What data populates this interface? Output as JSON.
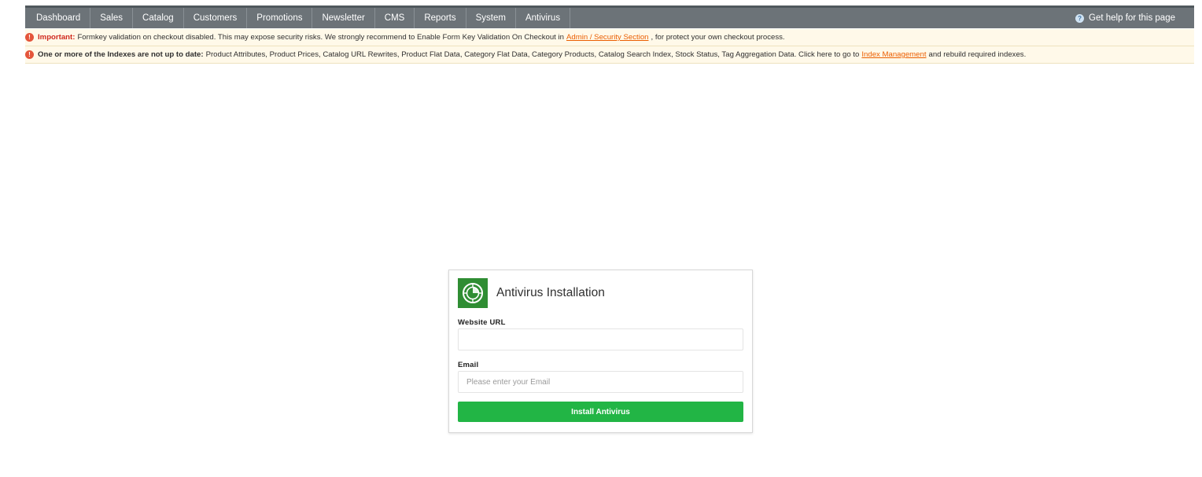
{
  "nav": {
    "items": [
      {
        "label": "Dashboard"
      },
      {
        "label": "Sales"
      },
      {
        "label": "Catalog"
      },
      {
        "label": "Customers"
      },
      {
        "label": "Promotions"
      },
      {
        "label": "Newsletter"
      },
      {
        "label": "CMS"
      },
      {
        "label": "Reports"
      },
      {
        "label": "System"
      },
      {
        "label": "Antivirus"
      }
    ],
    "help_icon": "question-circle-icon",
    "help_label": "Get help for this page"
  },
  "notices": [
    {
      "icon": "alert-circle-icon",
      "heading": "Important:",
      "text_before": "Formkey validation on checkout disabled. This may expose security risks. We strongly recommend to Enable Form Key Validation On Checkout in",
      "link": "Admin / Security Section",
      "text_after": ", for protect your own checkout process."
    },
    {
      "icon": "alert-circle-icon",
      "heading": "One or more of the Indexes are not up to date:",
      "text_before": "Product Attributes, Product Prices, Catalog URL Rewrites, Product Flat Data, Category Flat Data, Category Products, Catalog Search Index, Stock Status, Tag Aggregation Data. Click here to go to",
      "link": "Index Management",
      "text_after": "and rebuild required indexes."
    }
  ],
  "card": {
    "logo_icon": "antivirus-target-icon",
    "title": "Antivirus Installation",
    "url_label": "Website URL",
    "url_value": "",
    "email_label": "Email",
    "email_placeholder": "Please enter your Email",
    "button_label": "Install Antivirus"
  },
  "colors": {
    "nav_bg": "#6c7378",
    "notice_bg": "#fff9e9",
    "important_red": "#d02a1e",
    "link_orange": "#eb5e00",
    "logo_green": "#2f8d33",
    "button_green": "#22b545"
  }
}
